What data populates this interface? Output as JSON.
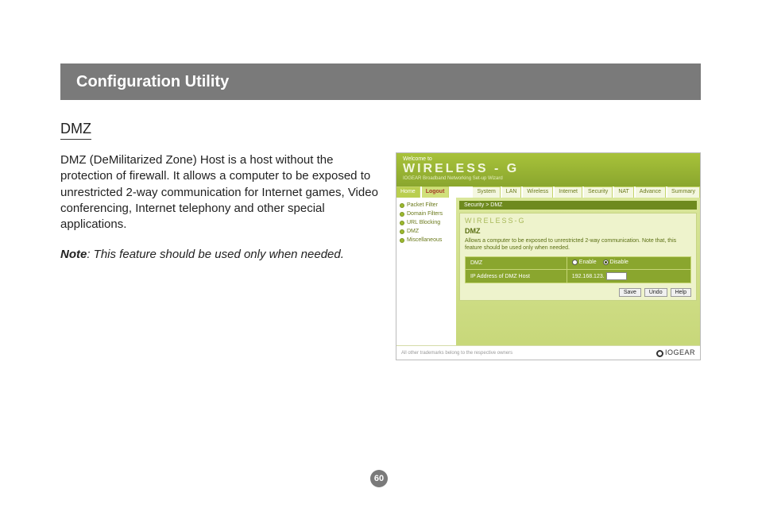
{
  "title_bar": "Configuration Utility",
  "section_heading": "DMZ",
  "body_text": "DMZ (DeMilitarized Zone) Host is a host without the protection of firewall. It allows a computer to be exposed to unrestricted 2-way communication for Internet games, Video conferencing, Internet telephony and other special applications.",
  "note_label": "Note",
  "note_text": ": This feature should be used only when needed.",
  "page_number": "60",
  "shot": {
    "welcome": "Welcome to",
    "logo": "WIRELESS - G",
    "logo_sub": "IOGEAR Broadband Networking Set-up Wizard",
    "tabs": {
      "home": "Home",
      "logout": "Logout",
      "system": "System",
      "lan": "LAN",
      "wireless": "Wireless",
      "internet": "Internet",
      "security": "Security",
      "nat": "NAT",
      "advance": "Advance",
      "summary": "Summary"
    },
    "side": {
      "packet": "Packet Filter",
      "domain": "Domain Filters",
      "url": "URL Blocking",
      "dmz": "DMZ",
      "misc": "Miscellaneous"
    },
    "crumb": "Security > DMZ",
    "cardlogo": "WIRELESS-G",
    "cardh": "DMZ",
    "carddesc": "Allows a computer to be exposed to unrestricted 2-way communication. Note that, this feature should be used only when needed.",
    "row1_label": "DMZ",
    "enable": "Enable",
    "disable": "Disable",
    "row2_label": "IP Address of DMZ Host",
    "ip_prefix": "192.168.123.",
    "btn_save": "Save",
    "btn_undo": "Undo",
    "btn_help": "Help",
    "footer_left": "All other trademarks belong to the respective owners",
    "footer_right": "IOGEAR"
  }
}
